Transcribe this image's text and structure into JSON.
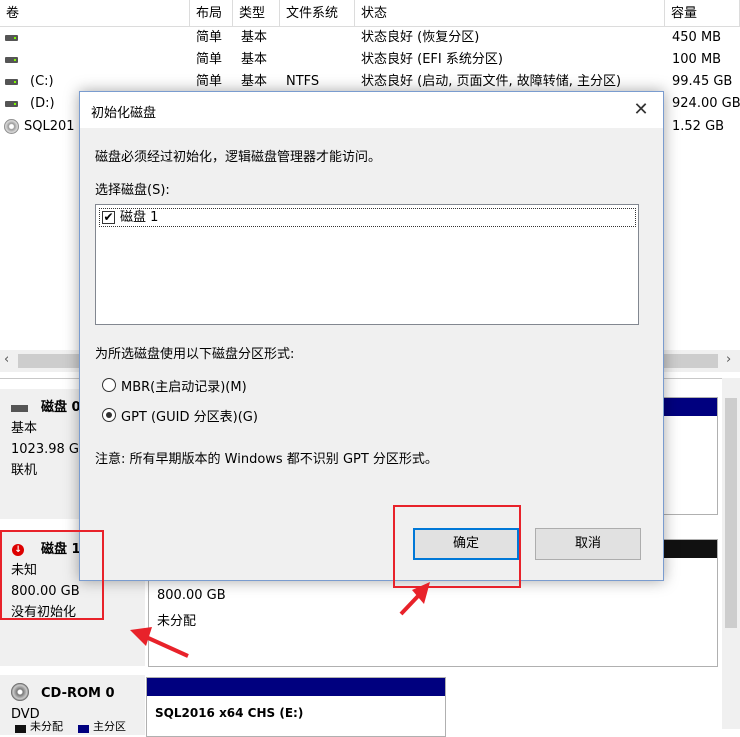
{
  "table": {
    "headers": {
      "vol": "卷",
      "layout": "布局",
      "type": "类型",
      "fs": "文件系统",
      "status": "状态",
      "capacity": "容量"
    },
    "rows": [
      {
        "vol": "",
        "layout": "简单",
        "type": "基本",
        "fs": "",
        "status": "状态良好 (恢复分区)",
        "capacity": "450 MB"
      },
      {
        "vol": "",
        "layout": "简单",
        "type": "基本",
        "fs": "",
        "status": "状态良好 (EFI 系统分区)",
        "capacity": "100 MB"
      },
      {
        "vol": "(C:)",
        "layout": "简单",
        "type": "基本",
        "fs": "NTFS",
        "status": "状态良好 (启动, 页面文件, 故障转储, 主分区)",
        "capacity": "99.45 GB"
      },
      {
        "vol": "(D:)",
        "layout": "",
        "type": "",
        "fs": "",
        "status": "",
        "capacity": "924.00 GB"
      },
      {
        "vol": "SQL201",
        "layout": "",
        "type": "",
        "fs": "",
        "status": "",
        "capacity": "1.52 GB"
      }
    ]
  },
  "disks": {
    "disk0": {
      "name": "磁盘 0",
      "type": "基本",
      "size": "1023.98 G",
      "state": "联机"
    },
    "disk1": {
      "name": "磁盘 1",
      "type": "未知",
      "size": "800.00 GB",
      "state": "没有初始化",
      "partition_size": "800.00 GB",
      "partition_state": "未分配"
    },
    "cdrom": {
      "name": "CD-ROM 0",
      "type": "DVD",
      "volume": "SQL2016 x64 CHS (E:)"
    },
    "legend": {
      "unallocated": "未分配",
      "primary": "主分区"
    }
  },
  "dialog": {
    "title": "初始化磁盘",
    "message": "磁盘必须经过初始化，逻辑磁盘管理器才能访问。",
    "select_label": "选择磁盘(S):",
    "disk_items": [
      {
        "label": "磁盘 1",
        "checked": true
      }
    ],
    "style_label": "为所选磁盘使用以下磁盘分区形式:",
    "mbr_label": "MBR(主启动记录)(M)",
    "gpt_label": "GPT (GUID 分区表)(G)",
    "selected_style": "GPT",
    "note": "注意: 所有早期版本的 Windows 都不识别 GPT 分区形式。",
    "ok_label": "确定",
    "cancel_label": "取消"
  },
  "colors": {
    "highlight": "#e8222a",
    "volume_bar": "#00007f",
    "focus": "#0078d7"
  }
}
